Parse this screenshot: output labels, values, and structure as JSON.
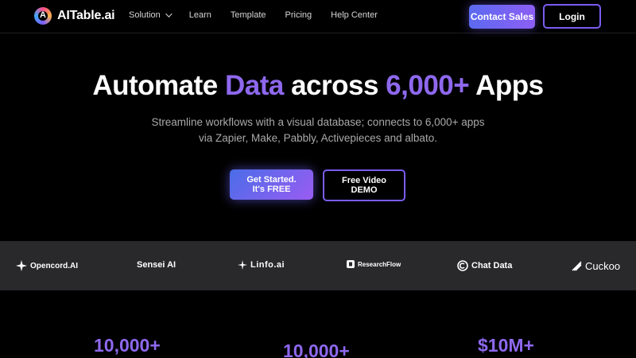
{
  "brand": {
    "name": "AITable.ai",
    "logo_letter": "A"
  },
  "nav": {
    "items": [
      {
        "label": "Solution",
        "has_dropdown": true
      },
      {
        "label": "Learn"
      },
      {
        "label": "Template"
      },
      {
        "label": "Pricing"
      },
      {
        "label": "Help Center"
      }
    ],
    "contact_sales": "Contact Sales",
    "login": "Login"
  },
  "hero": {
    "title_part1": "Automate ",
    "title_accent1": "Data",
    "title_part2": " across ",
    "title_accent2": "6,000+",
    "title_part3": " Apps",
    "subtitle_line1": "Streamline workflows with a visual database; connects to 6,000+ apps",
    "subtitle_line2": "via Zapier, Make, Pabbly, Activepieces and albato.",
    "cta_primary_line1": "Get Started.",
    "cta_primary_line2": "It's FREE",
    "cta_secondary_line1": "Free Video",
    "cta_secondary_line2": "DEMO"
  },
  "partners": [
    {
      "name": "Opencord.AI",
      "icon": "opencord-icon"
    },
    {
      "name": "Sensei AI",
      "icon": ""
    },
    {
      "name": "Linfo.ai",
      "icon": "linfo-icon"
    },
    {
      "name": "ResearchFlow",
      "icon": "researchflow-icon"
    },
    {
      "name": "Chat Data",
      "icon": "chatdata-icon"
    },
    {
      "name": "Cuckoo",
      "icon": "cuckoo-icon"
    }
  ],
  "stats": [
    {
      "value": "10,000+"
    },
    {
      "value": "10,000+"
    },
    {
      "value": "$10M+"
    }
  ],
  "colors": {
    "accent": "#8e68ee",
    "button_gradient_start": "#4a6de8",
    "button_gradient_end": "#9a5cf2",
    "band": "#29292c"
  }
}
